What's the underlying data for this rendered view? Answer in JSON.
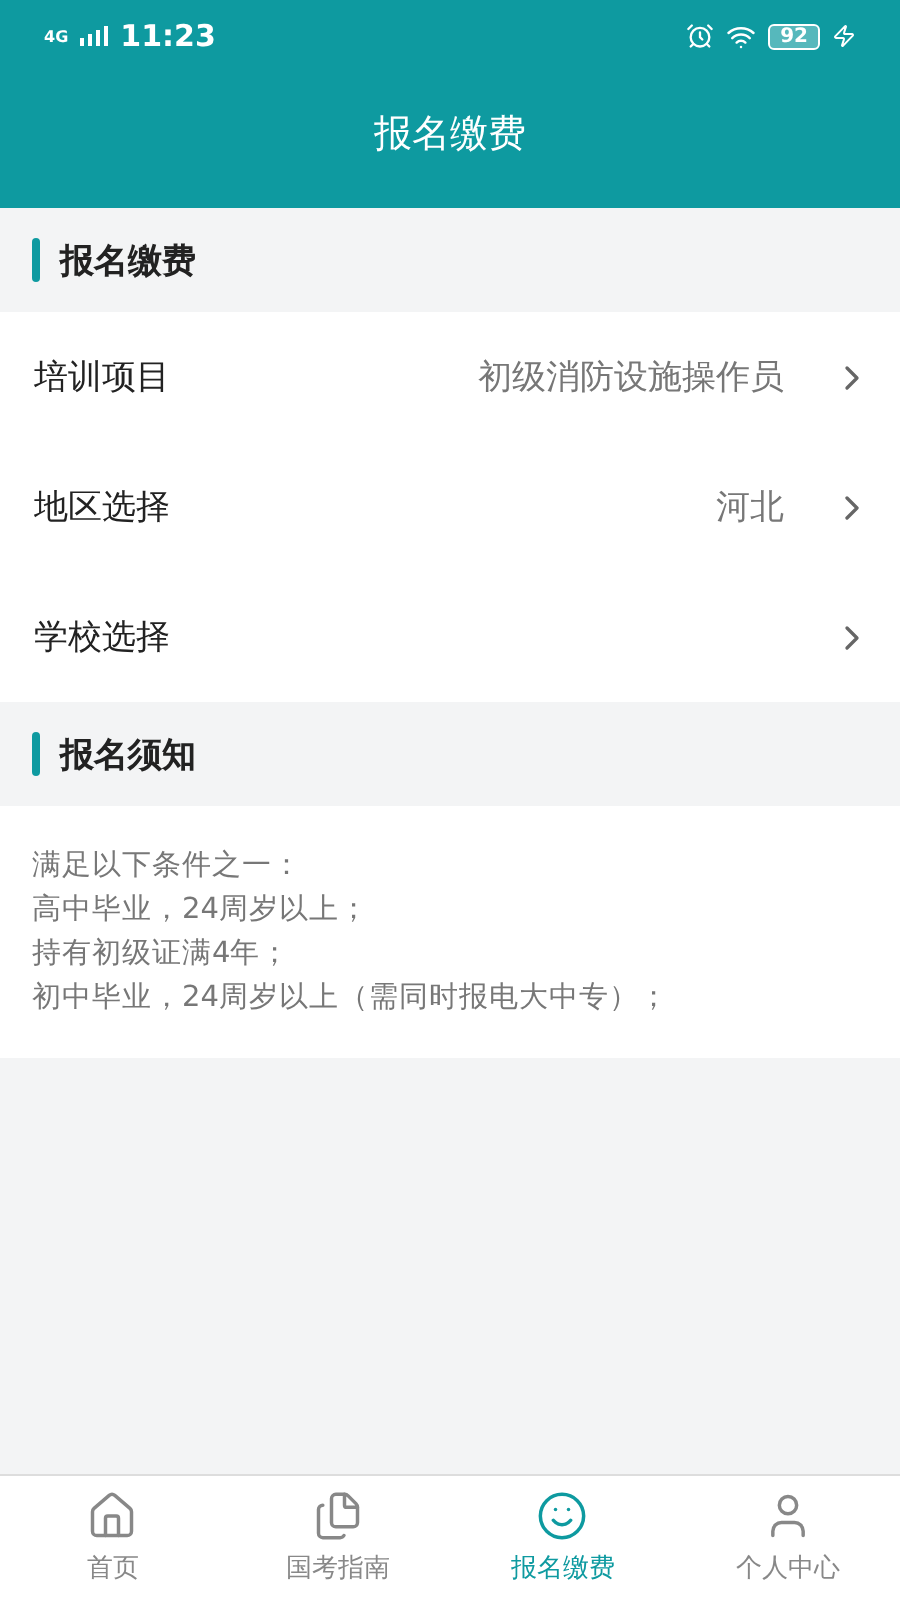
{
  "status_bar": {
    "network": "4G",
    "time": "11:23",
    "battery": "92"
  },
  "header": {
    "title": "报名缴费"
  },
  "sections": [
    {
      "title": "报名缴费",
      "kind": "rows",
      "rows": [
        {
          "label": "培训项目",
          "value": "初级消防设施操作员"
        },
        {
          "label": "地区选择",
          "value": "河北"
        },
        {
          "label": "学校选择"
        }
      ]
    },
    {
      "title": "报名须知",
      "kind": "notes",
      "lines": [
        "满足以下条件之一：",
        "高中毕业，24周岁以上；",
        "持有初级证满4年；",
        "初中毕业，24周岁以上（需同时报电大中专）；"
      ]
    }
  ],
  "tab_bar": [
    {
      "label": "首页",
      "selected": false
    },
    {
      "label": "国考指南",
      "selected": false
    },
    {
      "label": "报名缴费",
      "selected": true
    },
    {
      "label": "个人中心",
      "selected": false
    }
  ]
}
